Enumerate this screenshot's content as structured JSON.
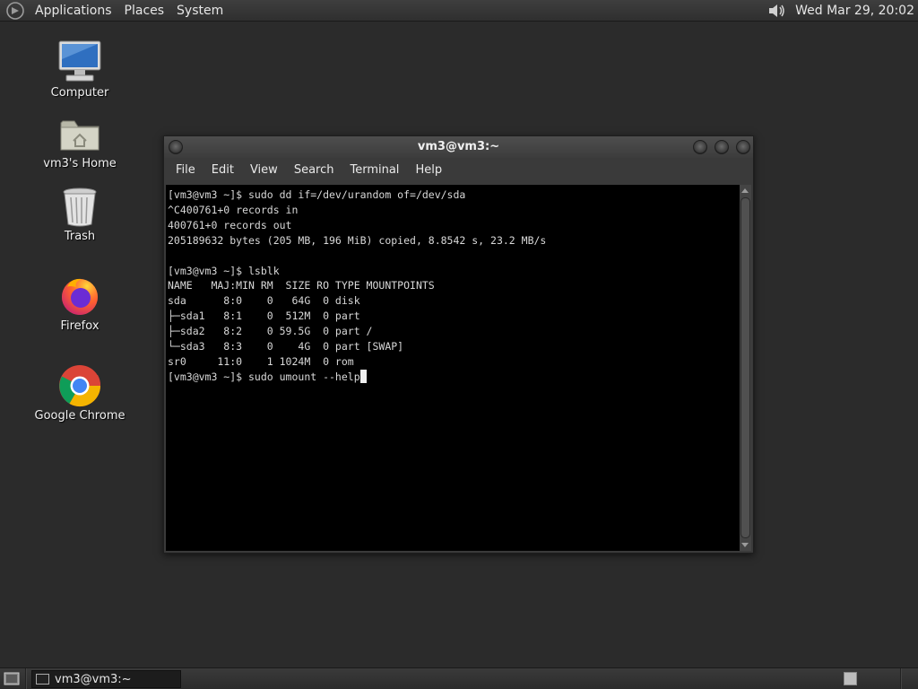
{
  "top_panel": {
    "menus": [
      "Applications",
      "Places",
      "System"
    ],
    "clock": "Wed Mar 29, 20:02"
  },
  "desktop": {
    "icons": [
      {
        "label": "Computer"
      },
      {
        "label": "vm3's Home"
      },
      {
        "label": "Trash"
      },
      {
        "label": "Firefox"
      },
      {
        "label": "Google Chrome"
      }
    ]
  },
  "terminal": {
    "title": "vm3@vm3:~",
    "menus": [
      "File",
      "Edit",
      "View",
      "Search",
      "Terminal",
      "Help"
    ],
    "lines": [
      "[vm3@vm3 ~]$ sudo dd if=/dev/urandom of=/dev/sda",
      "^C400761+0 records in",
      "400761+0 records out",
      "205189632 bytes (205 MB, 196 MiB) copied, 8.8542 s, 23.2 MB/s",
      "",
      "[vm3@vm3 ~]$ lsblk",
      "NAME   MAJ:MIN RM  SIZE RO TYPE MOUNTPOINTS",
      "sda      8:0    0   64G  0 disk",
      "├─sda1   8:1    0  512M  0 part",
      "├─sda2   8:2    0 59.5G  0 part /",
      "└─sda3   8:3    0    4G  0 part [SWAP]",
      "sr0     11:0    1 1024M  0 rom"
    ],
    "prompt_line": "[vm3@vm3 ~]$ sudo umount --help"
  },
  "bottom_panel": {
    "task_label": "vm3@vm3:~"
  },
  "colors": {
    "desktop_bg": "#2b2b2b",
    "terminal_bg": "#000000",
    "terminal_fg": "#d8d8d8"
  }
}
